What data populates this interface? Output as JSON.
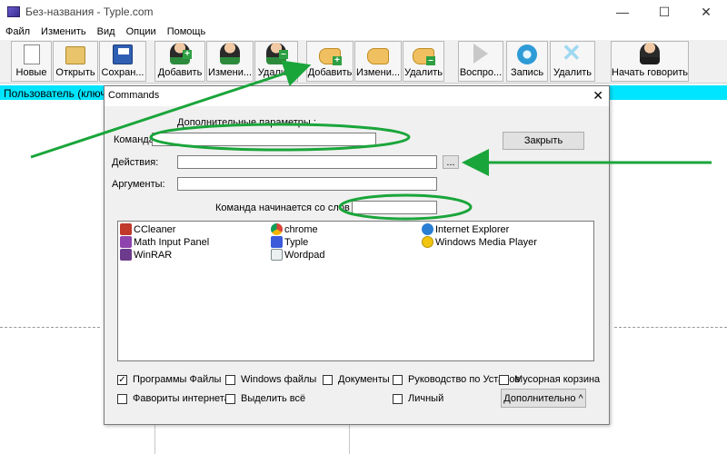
{
  "window": {
    "title": "Без-названия - Typle.com",
    "controls": {
      "minimize": "—",
      "maximize": "☐",
      "close": "✕"
    }
  },
  "menu": [
    "Файл",
    "Изменить",
    "Вид",
    "Опции",
    "Помощь"
  ],
  "toolbar": {
    "new": "Новые",
    "open": "Открыть",
    "save": "Сохран...",
    "add_user": "Добавить",
    "edit_user": "Измени...",
    "delete_user": "Удали...",
    "add_command": "Добавить",
    "edit_command": "Измени...",
    "delete_command": "Удалить",
    "play": "Воспро...",
    "record": "Запись",
    "delete_record": "Удалить",
    "start_speaking": "Начать говорить"
  },
  "background": {
    "user_bar": "Пользователь (ключе"
  },
  "dialog": {
    "title": "Commands",
    "close_x": "✕",
    "advanced_params_label": "Дополнительные параметры :",
    "command_label": "Команда:",
    "command_value": "",
    "actions_label": "Действия:",
    "actions_value": "",
    "browse_button": "...",
    "arguments_label": "Аргументы:",
    "arguments_value": "",
    "starts_with_label": "Команда начинается со слов :",
    "starts_with_value": "",
    "close_button": "Закрыть",
    "apps": [
      {
        "name": "CCleaner",
        "icon": "ccleaner-icon"
      },
      {
        "name": "Math Input Panel",
        "icon": "math-input-icon"
      },
      {
        "name": "WinRAR",
        "icon": "winrar-icon"
      },
      {
        "name": "chrome",
        "icon": "chrome-icon"
      },
      {
        "name": "Typle",
        "icon": "typle-icon"
      },
      {
        "name": "Wordpad",
        "icon": "wordpad-icon"
      },
      {
        "name": "Internet Explorer",
        "icon": "ie-icon"
      },
      {
        "name": "Windows Media Player",
        "icon": "wmp-icon"
      }
    ],
    "checkboxes": [
      {
        "label": "Программы Файлы",
        "checked": true
      },
      {
        "label": "Windows файлы",
        "checked": false
      },
      {
        "label": "Документы",
        "checked": false
      },
      {
        "label": "Руководство по Установ",
        "checked": false
      },
      {
        "label": "Мусорная корзина",
        "checked": false
      },
      {
        "label": "Фавориты интернета",
        "checked": false
      },
      {
        "label": "Выделить всё",
        "checked": false
      },
      {
        "label": "Личный",
        "checked": false
      }
    ],
    "advanced_button": "Дополнительно ^"
  },
  "colors": {
    "highlight_bar": "#00e5ff",
    "annotation": "#1aa53a"
  }
}
